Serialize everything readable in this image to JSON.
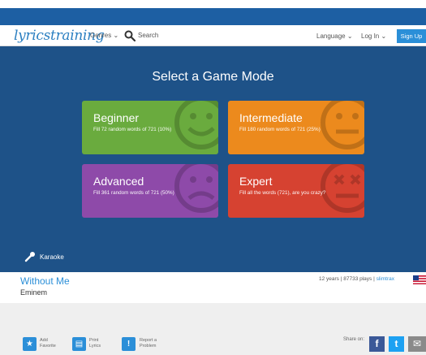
{
  "nav": {
    "logo": "lyricstraining",
    "genres_label": "Genres ⌄",
    "search_label": "Search",
    "language_label": "Language ⌄",
    "login_label": "Log In ⌄",
    "signup_label": "Sign Up"
  },
  "game_mode": {
    "title": "Select a Game Mode",
    "modes": [
      {
        "title": "Beginner",
        "description": "Fill 72 random words of 721 (10%)",
        "face": "smile",
        "color": "#6aab3e"
      },
      {
        "title": "Intermediate",
        "description": "Fill 180 random words of 721 (25%)",
        "face": "neutral",
        "color": "#ec8a1d"
      },
      {
        "title": "Advanced",
        "description": "Fill 361 random words of 721 (50%)",
        "face": "sad",
        "color": "#8e4aa9"
      },
      {
        "title": "Expert",
        "description": "Fill all the words (721), are you crazy?",
        "face": "dead",
        "color": "#d64231"
      }
    ],
    "karaoke_label": "Karaoke"
  },
  "song": {
    "title": "Without Me",
    "artist": "Eminem",
    "stats": "12 years | 87733 plays | ",
    "uploader": "slimtrax"
  },
  "footer": {
    "actions": [
      {
        "label": "Add\nFavorite",
        "icon": "star-icon"
      },
      {
        "label": "Print\nLyrics",
        "icon": "print-icon"
      },
      {
        "label": "Report a\nProblem",
        "icon": "exclamation-icon"
      }
    ],
    "share_label": "Share on:",
    "share_buttons": [
      {
        "glyph": "f",
        "icon": "facebook-icon",
        "color": "#3b5998"
      },
      {
        "glyph": "t",
        "icon": "twitter-icon",
        "color": "#1da1f2"
      },
      {
        "glyph": "✉",
        "icon": "email-icon",
        "color": "#8a8a8a"
      }
    ]
  },
  "colors": {
    "top_bar": "#1d5fa3",
    "stage": "#1e5288",
    "accent": "#2b8fd8"
  }
}
